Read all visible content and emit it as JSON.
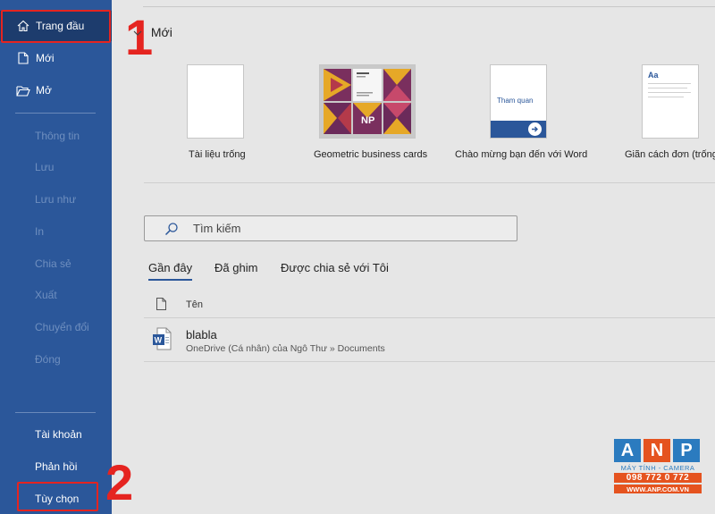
{
  "sidebar": {
    "home": "Trang đầu",
    "new": "Mới",
    "open": "Mở",
    "disabled_items": [
      "Thông tin",
      "Lưu",
      "Lưu như",
      "In",
      "Chia sẻ",
      "Xuất",
      "Chuyển đổi",
      "Đóng"
    ],
    "account": "Tài khoản",
    "feedback": "Phản hồi",
    "options": "Tùy chọn"
  },
  "annotations": {
    "step1": "1",
    "step2": "2"
  },
  "main": {
    "section_title": "Mới",
    "templates": [
      {
        "label": "Tài liệu trống"
      },
      {
        "label": "Geometric business cards"
      },
      {
        "label": "Chào mừng bạn đến với Word",
        "thumb_text": "Tham quan"
      },
      {
        "label": "Giãn cách đơn (trống)",
        "thumb_text": "Aa"
      }
    ],
    "search_placeholder": "Tìm kiếm",
    "tabs": [
      "Gần đây",
      "Đã ghim",
      "Được chia sẻ với Tôi"
    ],
    "column_header": "Tên",
    "files": [
      {
        "name": "blabla",
        "location": "OneDrive (Cá nhân) của Ngô Thư » Documents"
      }
    ]
  },
  "watermark": {
    "letters": [
      "A",
      "N",
      "P"
    ],
    "tagline": "MÁY TÍNH - CAMERA",
    "phone": "098 772 0 772",
    "website": "WWW.ANP.COM.VN"
  },
  "colors": {
    "sidebar": "#2b579a",
    "annotation": "#e52420",
    "accent_orange": "#e5531f",
    "accent_blue": "#2b7bbf"
  }
}
